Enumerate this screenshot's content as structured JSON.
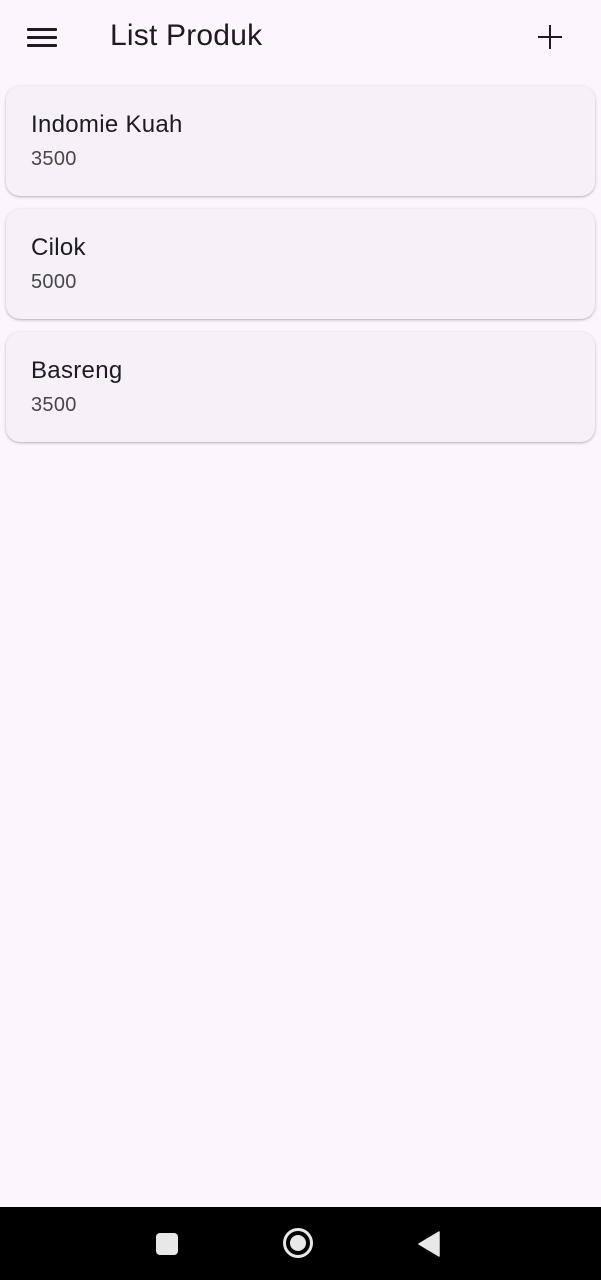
{
  "app_bar": {
    "title": "List Produk",
    "menu_icon": "hamburger-menu-icon",
    "add_icon": "plus-icon"
  },
  "products": [
    {
      "name": "Indomie Kuah",
      "price": "3500"
    },
    {
      "name": "Cilok",
      "price": "5000"
    },
    {
      "name": "Basreng",
      "price": "3500"
    }
  ],
  "nav_bar": {
    "recents_icon": "square-icon",
    "home_icon": "circle-icon",
    "back_icon": "triangle-back-icon"
  },
  "colors": {
    "background": "#fcf6fc",
    "card": "#f5f1f6",
    "text_primary": "#1d1b20",
    "text_secondary": "#49454f",
    "nav_bar": "#000000"
  }
}
